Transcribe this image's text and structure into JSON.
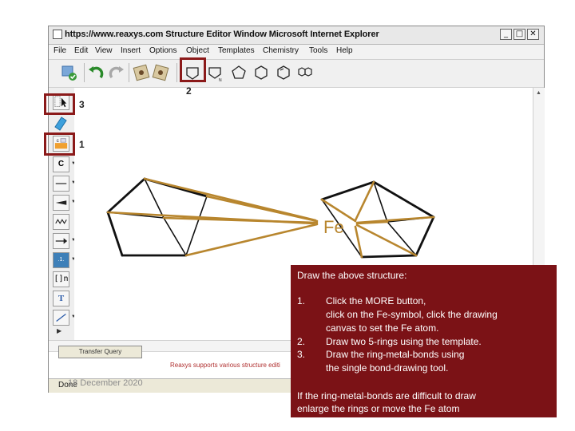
{
  "window": {
    "title": "https://www.reaxys.com  Structure Editor Window  Microsoft Internet Explorer",
    "buttons": [
      "_",
      "□",
      "✕"
    ]
  },
  "menu": [
    "File",
    "Edit",
    "View",
    "Insert",
    "Options",
    "Object",
    "Templates",
    "Chemistry",
    "Tools",
    "Help"
  ],
  "toolbar": {
    "ring_templates": [
      "cyclopropane",
      "cyclobutane",
      "cyclopentane",
      "cyclohexane",
      "benzene",
      "naphthalene"
    ]
  },
  "palette": {
    "carbon_label": "C",
    "charge_label": ".1.",
    "bracket_label": "[]n",
    "text_tool_label": "T"
  },
  "canvas": {
    "atom_label": "Fe"
  },
  "bottom": {
    "transfer_button": "Transfer Query",
    "support_text": "Reaxys supports various structure editi"
  },
  "status": {
    "text": "Done",
    "date": "18 December 2020"
  },
  "callouts": {
    "c1": "1",
    "c2": "2",
    "c3": "3"
  },
  "instructions": {
    "heading": "Draw the above structure:",
    "steps": [
      {
        "num": "1.",
        "lines": [
          "Click  the MORE button,",
          "click on the Fe-symbol, click the drawing",
          "canvas to set the Fe atom."
        ]
      },
      {
        "num": "2.",
        "lines": [
          "Draw two 5-rings using the template."
        ]
      },
      {
        "num": "3.",
        "lines": [
          "Draw the ring-metal-bonds using",
          "the single bond-drawing tool."
        ]
      }
    ],
    "footer": [
      "If the ring-metal-bonds are difficult to draw",
      "enlarge the rings or move the Fe atom"
    ]
  },
  "colors": {
    "callout_border": "#8b1a1a",
    "info_box": "#7b1216",
    "ring_metal_bond": "#b8862e"
  }
}
